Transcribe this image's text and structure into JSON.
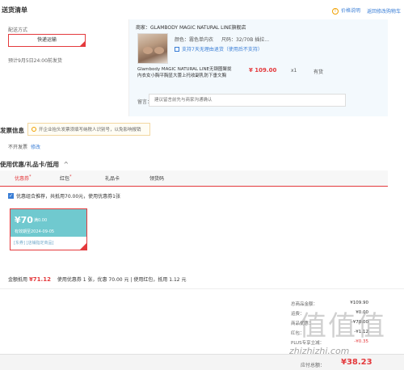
{
  "header": {
    "title": "送货清单",
    "price_note": "价格说明",
    "back_to_cart": "返回修改购物车",
    "info_glyph": "!"
  },
  "shipping": {
    "label": "配送方式",
    "option": "快递运输",
    "eta": "预计9月5日24:00前发货"
  },
  "product": {
    "shop": "商家：GLAMBODY MAGIC NATURAL LINE旗舰店",
    "color": "颜色：霧色单内衣",
    "size": "尺码：32/70B 插拉...",
    "support": "支持7天无理由退货（使用后不支持）",
    "name": "Glambody MAGIC NATURAL LINE无钢圈聚拢内衣女小胸平胸显大蕾上托收副乳防下垂文胸",
    "price": "¥ 109.00",
    "qty": "x1",
    "stock": "有货",
    "remark_label": "留言：",
    "remark_placeholder": "建议留言前先与商家沟通确认"
  },
  "invoice": {
    "title": "发票信息",
    "tip": "开企业抬头发票须填写纳税人识别号，以免影响报销",
    "status": "不开发票",
    "edit": "修改"
  },
  "coupons": {
    "title": "使用优惠/礼品卡/抵用",
    "chevron": "^",
    "tabs": [
      {
        "label": "优惠券",
        "mark": "*"
      },
      {
        "label": "红包",
        "mark": "*"
      },
      {
        "label": "礼品卡",
        "mark": ""
      },
      {
        "label": "领货码",
        "mark": ""
      }
    ],
    "auto_recommend": "优惠组合推荐，共抵用70.00元，使用优惠券1张",
    "check_glyph": "✓",
    "card": {
      "amount": "¥70",
      "condition": "满0.00",
      "validity": "有效期至2024-09-05",
      "scope": "[东券] [店铺指定商品]"
    },
    "summary_label": "金额抵用",
    "summary_amount": "¥71.12",
    "summary_detail": "使用优惠券 1 张，优惠 70.00 元 | 使用红包，抵用 1.12 元"
  },
  "totals": {
    "rows": [
      {
        "label": "总商品金额：",
        "value": "¥109.90"
      },
      {
        "label": "运费：",
        "value": "¥0.00"
      },
      {
        "label": "商品优惠：",
        "value": "-¥70.00"
      },
      {
        "label": "红包：",
        "value": "-¥1.12"
      },
      {
        "label": "PLUS专享立减：",
        "value": "-¥0.35"
      }
    ],
    "pay_label": "应付总额：",
    "pay_amount": "¥38.23"
  },
  "watermark": {
    "url": "zhizhizhi.com"
  }
}
